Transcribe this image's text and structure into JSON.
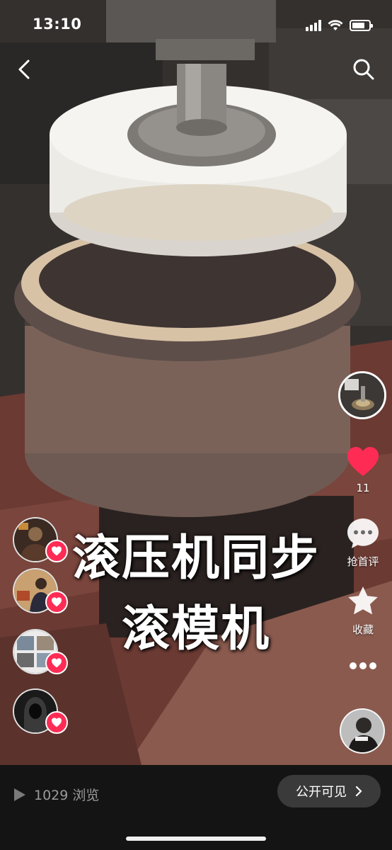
{
  "status_bar": {
    "time": "13:10"
  },
  "icons": {
    "back": "chevron-left-icon",
    "search": "search-icon",
    "like": "heart-icon",
    "comment": "comment-bubble-icon",
    "collect": "star-icon",
    "more": "more-dots-icon",
    "play": "play-icon",
    "arrow": "chevron-right-icon"
  },
  "right_rail": {
    "like_count": "11",
    "comment_label": "抢首评",
    "collect_label": "收藏"
  },
  "caption": {
    "line1": "滚压机同步",
    "line2": "滚模机"
  },
  "bottom_bar": {
    "views": "1029 浏览",
    "public_label": "公开可见"
  },
  "colors": {
    "like_red": "#fe2c55",
    "bottom_bg": "#141414",
    "button_bg": "#3a3a3a"
  }
}
